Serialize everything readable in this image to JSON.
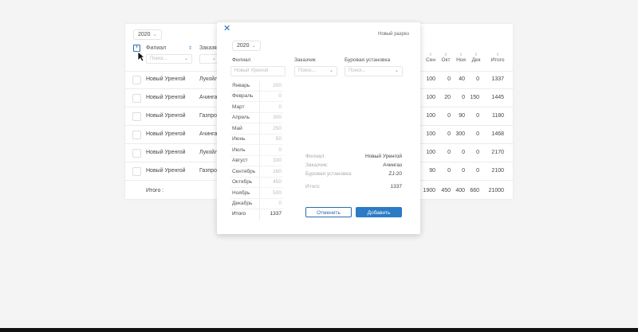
{
  "table": {
    "year": "2020",
    "columns": {
      "branch": "Филиал",
      "customer": "Заказчи",
      "branch_filter_placeholder": "Поиск...",
      "customer_filter_placeholder": "Поиск...",
      "months": [
        "Сен",
        "Окт",
        "Ноя",
        "Дек"
      ],
      "total": "Итого"
    },
    "rows": [
      {
        "branch": "Новый Уренгой",
        "customer": "Лукойл",
        "values": [
          "100",
          "0",
          "40",
          "0"
        ],
        "total": "1337"
      },
      {
        "branch": "Новый Уренгой",
        "customer": "Ачинга",
        "values": [
          "100",
          "20",
          "0",
          "150"
        ],
        "total": "1445"
      },
      {
        "branch": "Новый Уренгой",
        "customer": "Газпро",
        "values": [
          "100",
          "0",
          "90",
          "0"
        ],
        "total": "1180"
      },
      {
        "branch": "Новый Уренгой",
        "customer": "Ачинга",
        "values": [
          "100",
          "0",
          "300",
          "0"
        ],
        "total": "1468"
      },
      {
        "branch": "Новый Уренгой",
        "customer": "Лукойл",
        "values": [
          "100",
          "0",
          "0",
          "0"
        ],
        "total": "2170"
      },
      {
        "branch": "Новый Уренгой",
        "customer": "Газпро",
        "values": [
          "90",
          "0",
          "0",
          "0"
        ],
        "total": "2100"
      }
    ],
    "footer": {
      "label": "Итого :",
      "values": [
        "1900",
        "450",
        "400",
        "660"
      ],
      "total": "21000"
    }
  },
  "modal": {
    "title": "Новый разрез",
    "year": "2020",
    "labels": {
      "branch": "Филиал",
      "customer": "Заказчик",
      "rig": "Буровая установка"
    },
    "branch_value": "Новый Уренгой",
    "customer_placeholder": "Поиск...",
    "rig_placeholder": "Поиск...",
    "months": [
      {
        "name": "Январь",
        "value": "200"
      },
      {
        "name": "Февраль",
        "value": "0"
      },
      {
        "name": "Март",
        "value": "0"
      },
      {
        "name": "Апрель",
        "value": "300"
      },
      {
        "name": "Май",
        "value": "250"
      },
      {
        "name": "Июнь",
        "value": "50"
      },
      {
        "name": "Июль",
        "value": "0"
      },
      {
        "name": "Август",
        "value": "330"
      },
      {
        "name": "Сентябрь",
        "value": "160"
      },
      {
        "name": "Октябрь",
        "value": "450"
      },
      {
        "name": "Ноябрь",
        "value": "500"
      },
      {
        "name": "Декабрь",
        "value": "0"
      }
    ],
    "total_label": "Итого",
    "total_value": "1337",
    "summary": {
      "branch_key": "Филиал:",
      "branch_val": "Новый Уренгой",
      "customer_key": "Заказчик:",
      "customer_val": "Ачингаз",
      "rig_key": "Буровая установка:",
      "rig_val": "ZJ-20",
      "total_key": "Итого:",
      "total_val": "1337"
    },
    "cancel_label": "Отменить",
    "add_label": "Добавить"
  },
  "colors": {
    "accent": "#2b7bc5"
  }
}
